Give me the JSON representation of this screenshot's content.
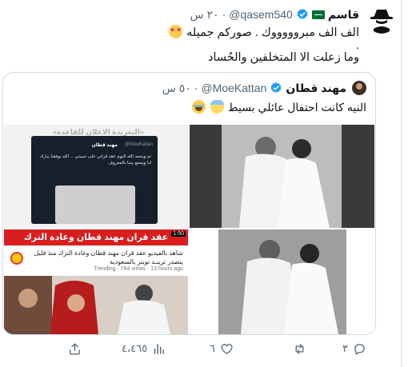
{
  "tweet": {
    "author_name": "قاسم",
    "handle": "@qasem540",
    "time": "٢٠ س",
    "separator": "·",
    "line1_text": "الف الف مبروووووك . صوركم جميله",
    "line2_text": ".",
    "line3_text": "وما زعلت الا المتخلفين والحُساد",
    "emoji_line1": "heart-eyes-emoji"
  },
  "quote": {
    "author_name": "مهند قطان",
    "handle": "@MoeKattan",
    "time": "٥٠ س",
    "separator": "·",
    "text": "النيه كانت احتفال عائلي بسيط",
    "emojis": [
      "baby-emoji",
      "laughing-emoji"
    ],
    "media": {
      "top_left": {
        "headline": "«التغريدة الاعلان للقاعدة»",
        "inner_name": "مهند قطان",
        "inner_handle": "@MoeKattan",
        "inner_text": "تم وبحمد الله اليوم عقد قراني على حبيبتي ... الله يوفقنا يبارك لنا ويجمع بيننا بالمعروف"
      },
      "bottom_left": {
        "banner": "عقد قران مهند قطان وعادة الترك",
        "duration": "1:50",
        "title": "شاهد بالفيديو عقد قران مهند قطان وغادة الترك منذ قليل يتصدر ترينـد تويتر بالسعودية",
        "meta": "Trending · 784 views · 13 hours ago"
      }
    }
  },
  "actions": {
    "reply_count": "٣",
    "retweet_count": "",
    "like_count": "٦",
    "views_count": "٤،٤٦٥"
  },
  "colors": {
    "text": "#0f1419",
    "muted": "#536471",
    "verified": "#1d9bf0",
    "border": "#cfd9de"
  }
}
